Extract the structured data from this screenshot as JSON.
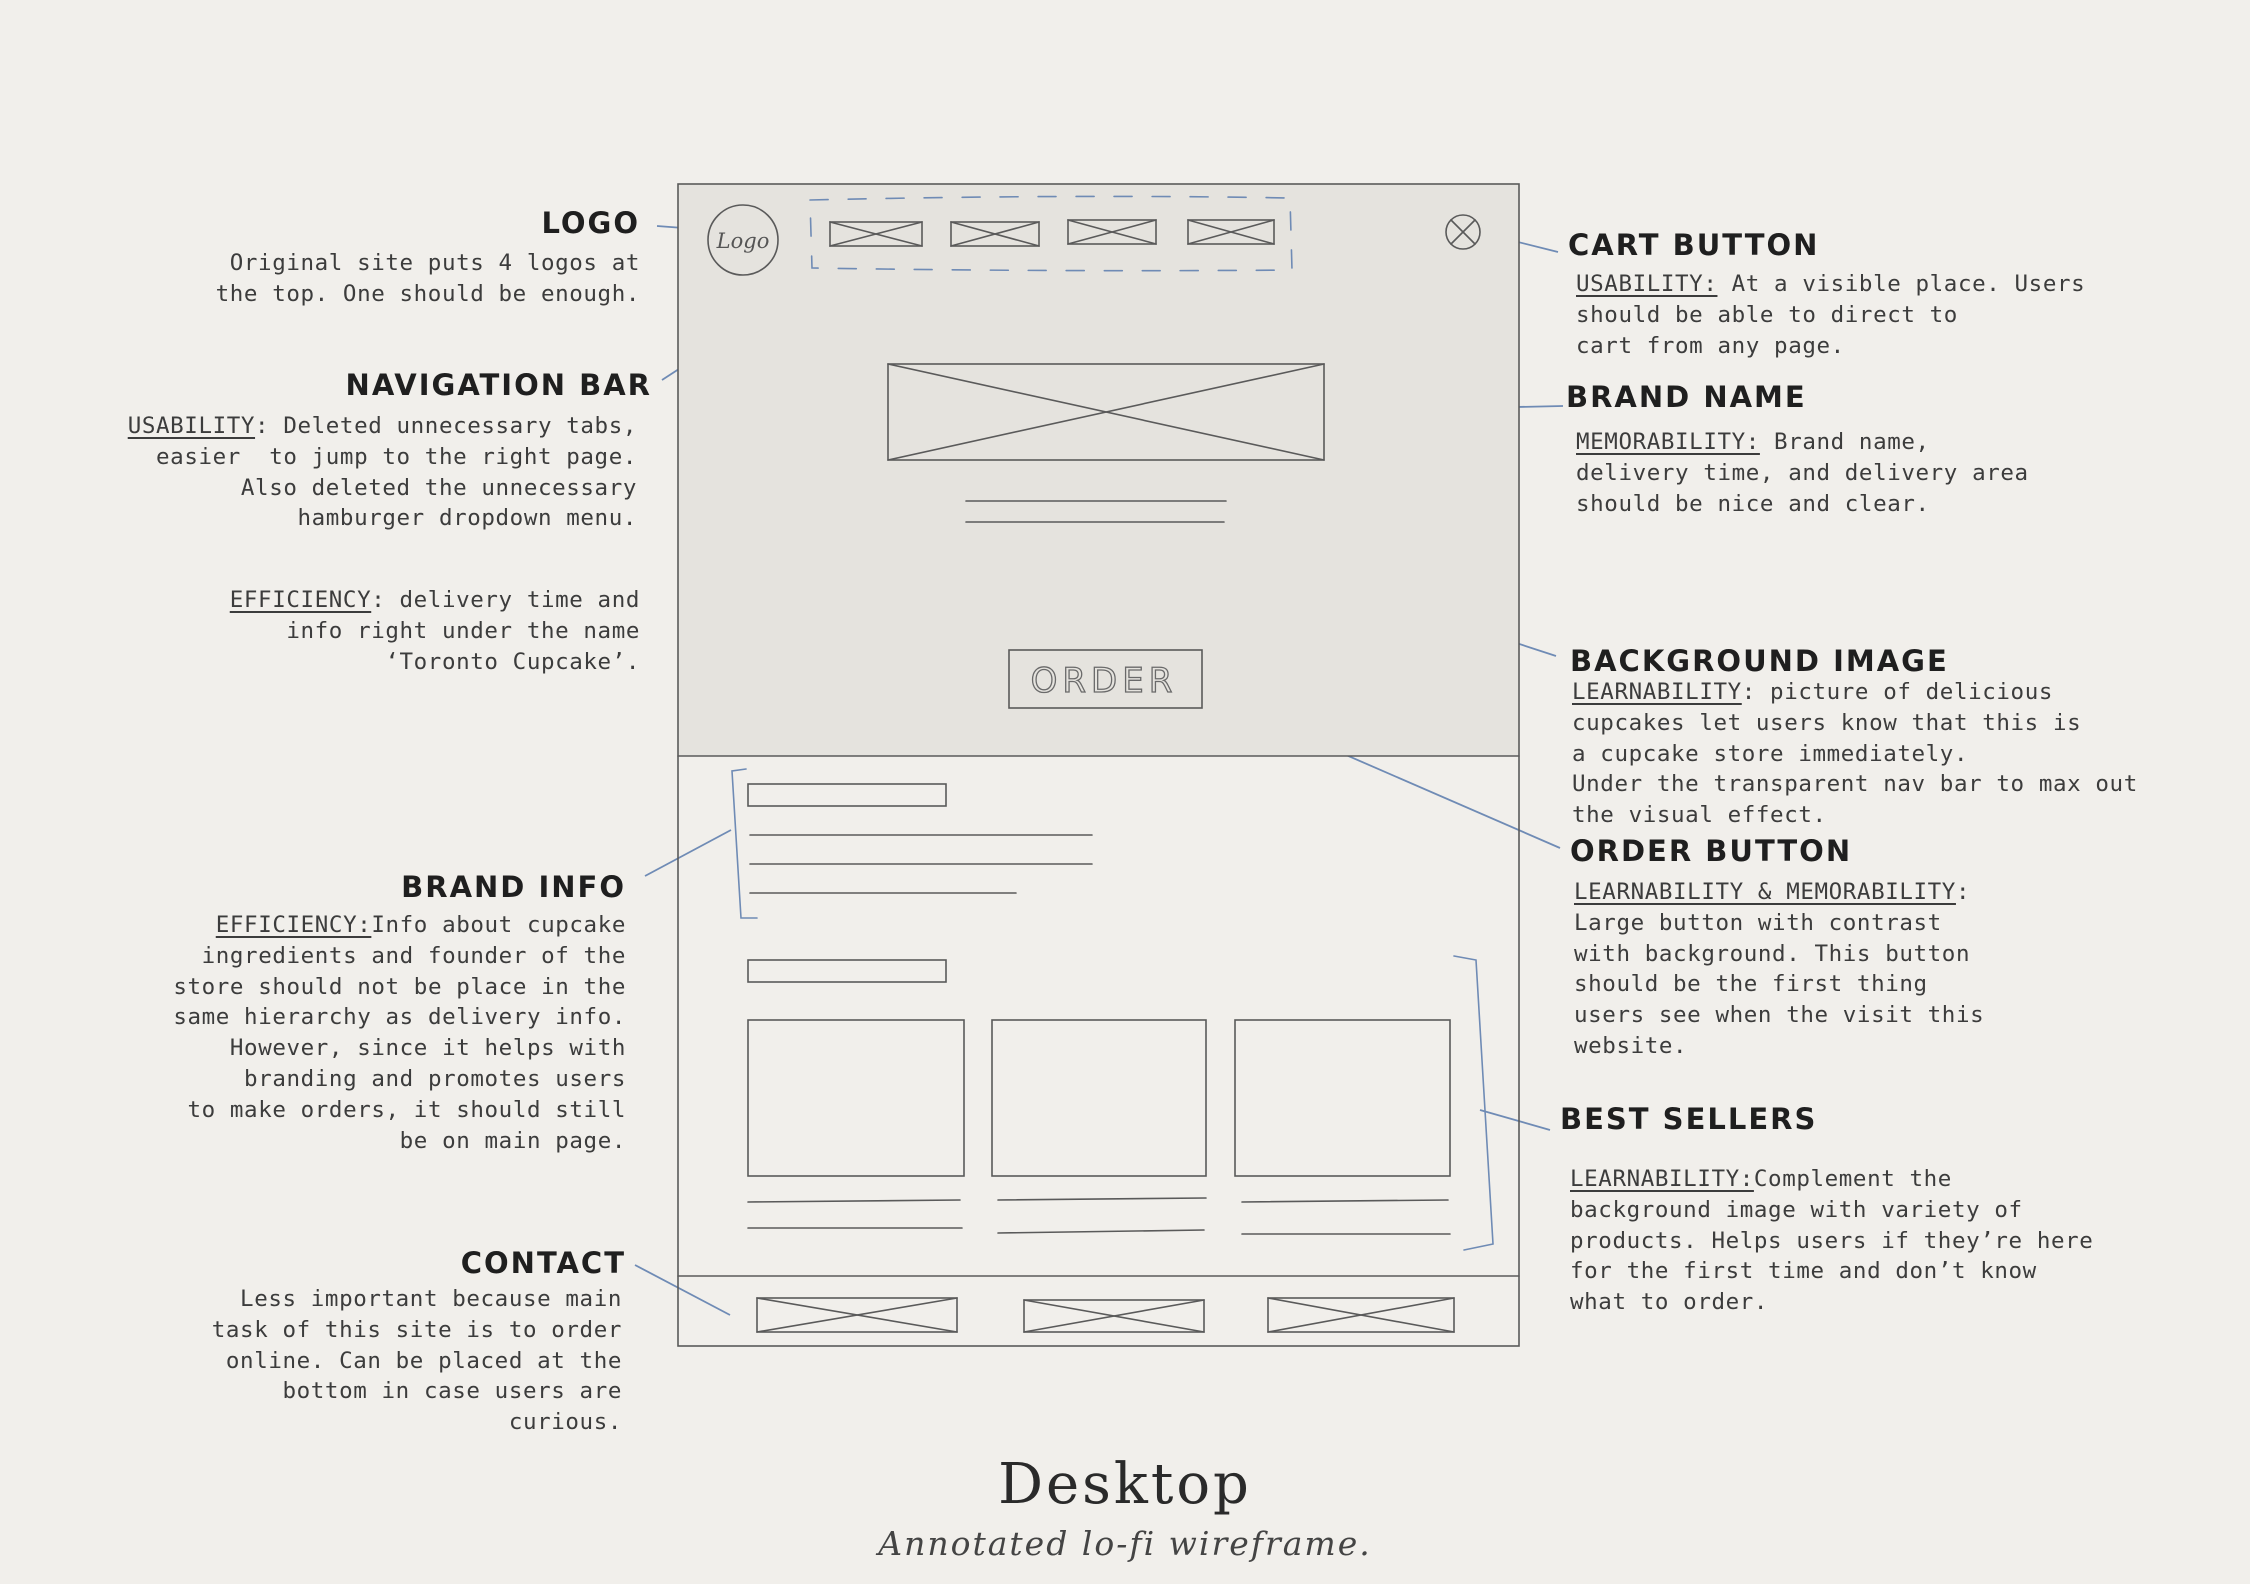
{
  "title": "Desktop",
  "subtitle": "Annotated lo-fi wireframe.",
  "wireframe": {
    "logo_label": "Logo",
    "order_label": "ORDER"
  },
  "annotations": {
    "logo": {
      "heading": "LOGO",
      "body": "Original site puts 4 logos at\nthe top. One should be enough."
    },
    "navigation_bar": {
      "heading": "NAVIGATION BAR",
      "keyword": "USABILITY",
      "body_first": ": Deleted unnecessary tabs,",
      "body_rest": "easier  to jump to the right page.\nAlso deleted the unnecessary\nhamburger dropdown menu.",
      "efficiency_keyword": "EFFICIENCY",
      "efficiency_first": ": delivery time and",
      "efficiency_rest": "info right under the name\n‘Toronto Cupcake’."
    },
    "brand_info": {
      "heading": "BRAND INFO",
      "keyword": "EFFICIENCY:",
      "body_first": "Info about cupcake",
      "body_rest": "ingredients and founder of the\nstore should not be place in the\nsame hierarchy as delivery info.\nHowever, since it helps with\nbranding and promotes users\nto make orders, it should still\nbe on main page."
    },
    "contact": {
      "heading": "CONTACT",
      "body": "Less important because main\ntask of this site is to order\nonline. Can be placed at the\nbottom in case users are\ncurious."
    },
    "cart_button": {
      "heading": "CART BUTTON",
      "keyword": "USABILITY:",
      "body_first": " At a visible place. Users",
      "body_rest": "should be able to direct to\ncart from any page."
    },
    "brand_name": {
      "heading": "BRAND NAME",
      "keyword": "MEMORABILITY:",
      "body_first": " Brand name,",
      "body_rest": "delivery time, and delivery area\nshould be nice and clear."
    },
    "background_image": {
      "heading": "BACKGROUND IMAGE",
      "keyword": "LEARNABILITY",
      "body_first": ": picture of delicious",
      "body_rest": "cupcakes let users know that this is\na cupcake store immediately.\nUnder the transparent nav bar to max out\nthe visual effect."
    },
    "order_button": {
      "heading": "ORDER BUTTON",
      "keyword": "LEARNABILITY & MEMORABILITY",
      "body_first": ":",
      "body_rest": "Large button with contrast\nwith background. This button\nshould be the first thing\nusers see when the visit this\nwebsite."
    },
    "best_sellers": {
      "heading": "BEST SELLERS",
      "keyword": "LEARNABILITY:",
      "body_first": "Complement the",
      "body_rest": "background image with variety of\nproducts. Helps users if they’re here\nfor the first time and don’t know\nwhat to order."
    }
  },
  "colors": {
    "background": "#f1efeb",
    "hero_fill": "#e5e3de",
    "sketch_stroke": "#5a5a5a",
    "connector": "#6f8bb5"
  }
}
